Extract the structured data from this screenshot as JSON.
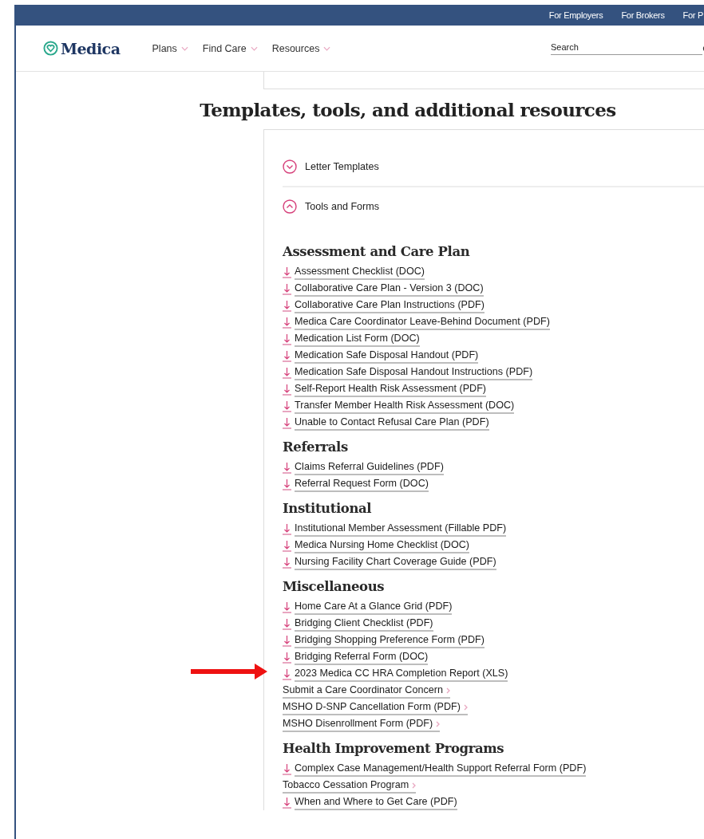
{
  "top_links": [
    "For Employers",
    "For Brokers",
    "For P"
  ],
  "logo": "Medica",
  "nav": [
    {
      "label": "Plans"
    },
    {
      "label": "Find Care"
    },
    {
      "label": "Resources"
    }
  ],
  "search": {
    "placeholder": "Search"
  },
  "heading": "Templates, tools, and additional resources",
  "accordion": [
    {
      "label": "Letter Templates",
      "expanded": false
    },
    {
      "label": "Tools and Forms",
      "expanded": true
    }
  ],
  "sections": [
    {
      "title": "Assessment and Care Plan",
      "items": [
        {
          "kind": "download",
          "label": "Assessment Checklist (DOC)",
          "highlighted": false
        },
        {
          "kind": "download",
          "label": "Collaborative Care Plan - Version 3 (DOC)",
          "highlighted": false
        },
        {
          "kind": "download",
          "label": "Collaborative Care Plan Instructions (PDF)",
          "highlighted": false
        },
        {
          "kind": "download",
          "label": "Medica Care Coordinator Leave-Behind Document (PDF)",
          "highlighted": false
        },
        {
          "kind": "download",
          "label": "Medication List Form (DOC)",
          "highlighted": false
        },
        {
          "kind": "download",
          "label": "Medication Safe Disposal Handout (PDF)",
          "highlighted": false
        },
        {
          "kind": "download",
          "label": "Medication Safe Disposal Handout Instructions (PDF)",
          "highlighted": false
        },
        {
          "kind": "download",
          "label": "Self-Report Health Risk Assessment (PDF)",
          "highlighted": false
        },
        {
          "kind": "download",
          "label": "Transfer Member Health Risk Assessment (DOC)",
          "highlighted": false
        },
        {
          "kind": "download",
          "label": "Unable to Contact Refusal Care Plan (PDF)",
          "highlighted": false
        }
      ]
    },
    {
      "title": "Referrals",
      "items": [
        {
          "kind": "download",
          "label": "Claims Referral Guidelines (PDF)",
          "highlighted": false
        },
        {
          "kind": "download",
          "label": "Referral Request Form (DOC)",
          "highlighted": false
        }
      ]
    },
    {
      "title": "Institutional",
      "items": [
        {
          "kind": "download",
          "label": "Institutional Member Assessment (Fillable PDF)",
          "highlighted": false
        },
        {
          "kind": "download",
          "label": "Medica Nursing Home Checklist (DOC)",
          "highlighted": false
        },
        {
          "kind": "download",
          "label": "Nursing Facility Chart Coverage Guide (PDF)",
          "highlighted": false
        }
      ]
    },
    {
      "title": "Miscellaneous",
      "items": [
        {
          "kind": "download",
          "label": "Home Care At a Glance Grid (PDF)",
          "highlighted": false
        },
        {
          "kind": "download",
          "label": "Bridging Client Checklist (PDF)",
          "highlighted": false
        },
        {
          "kind": "download",
          "label": "Bridging Shopping Preference Form (PDF)",
          "highlighted": false
        },
        {
          "kind": "download",
          "label": "Bridging Referral Form (DOC)",
          "highlighted": false
        },
        {
          "kind": "download",
          "label": "2023 Medica CC HRA Completion Report (XLS)",
          "highlighted": true
        },
        {
          "kind": "link",
          "label": "Submit a Care Coordinator Concern",
          "highlighted": false
        },
        {
          "kind": "link",
          "label": "MSHO D-SNP Cancellation Form (PDF)",
          "highlighted": false
        },
        {
          "kind": "link",
          "label": "MSHO Disenrollment Form (PDF)",
          "highlighted": false
        }
      ]
    },
    {
      "title": "Health Improvement Programs",
      "items": [
        {
          "kind": "download",
          "label": "Complex Case Management/Health Support Referral Form (PDF)",
          "highlighted": false
        },
        {
          "kind": "link",
          "label": "Tobacco Cessation Program",
          "highlighted": false
        },
        {
          "kind": "download",
          "label": "When and Where to Get Care (PDF)",
          "highlighted": false
        }
      ]
    }
  ]
}
